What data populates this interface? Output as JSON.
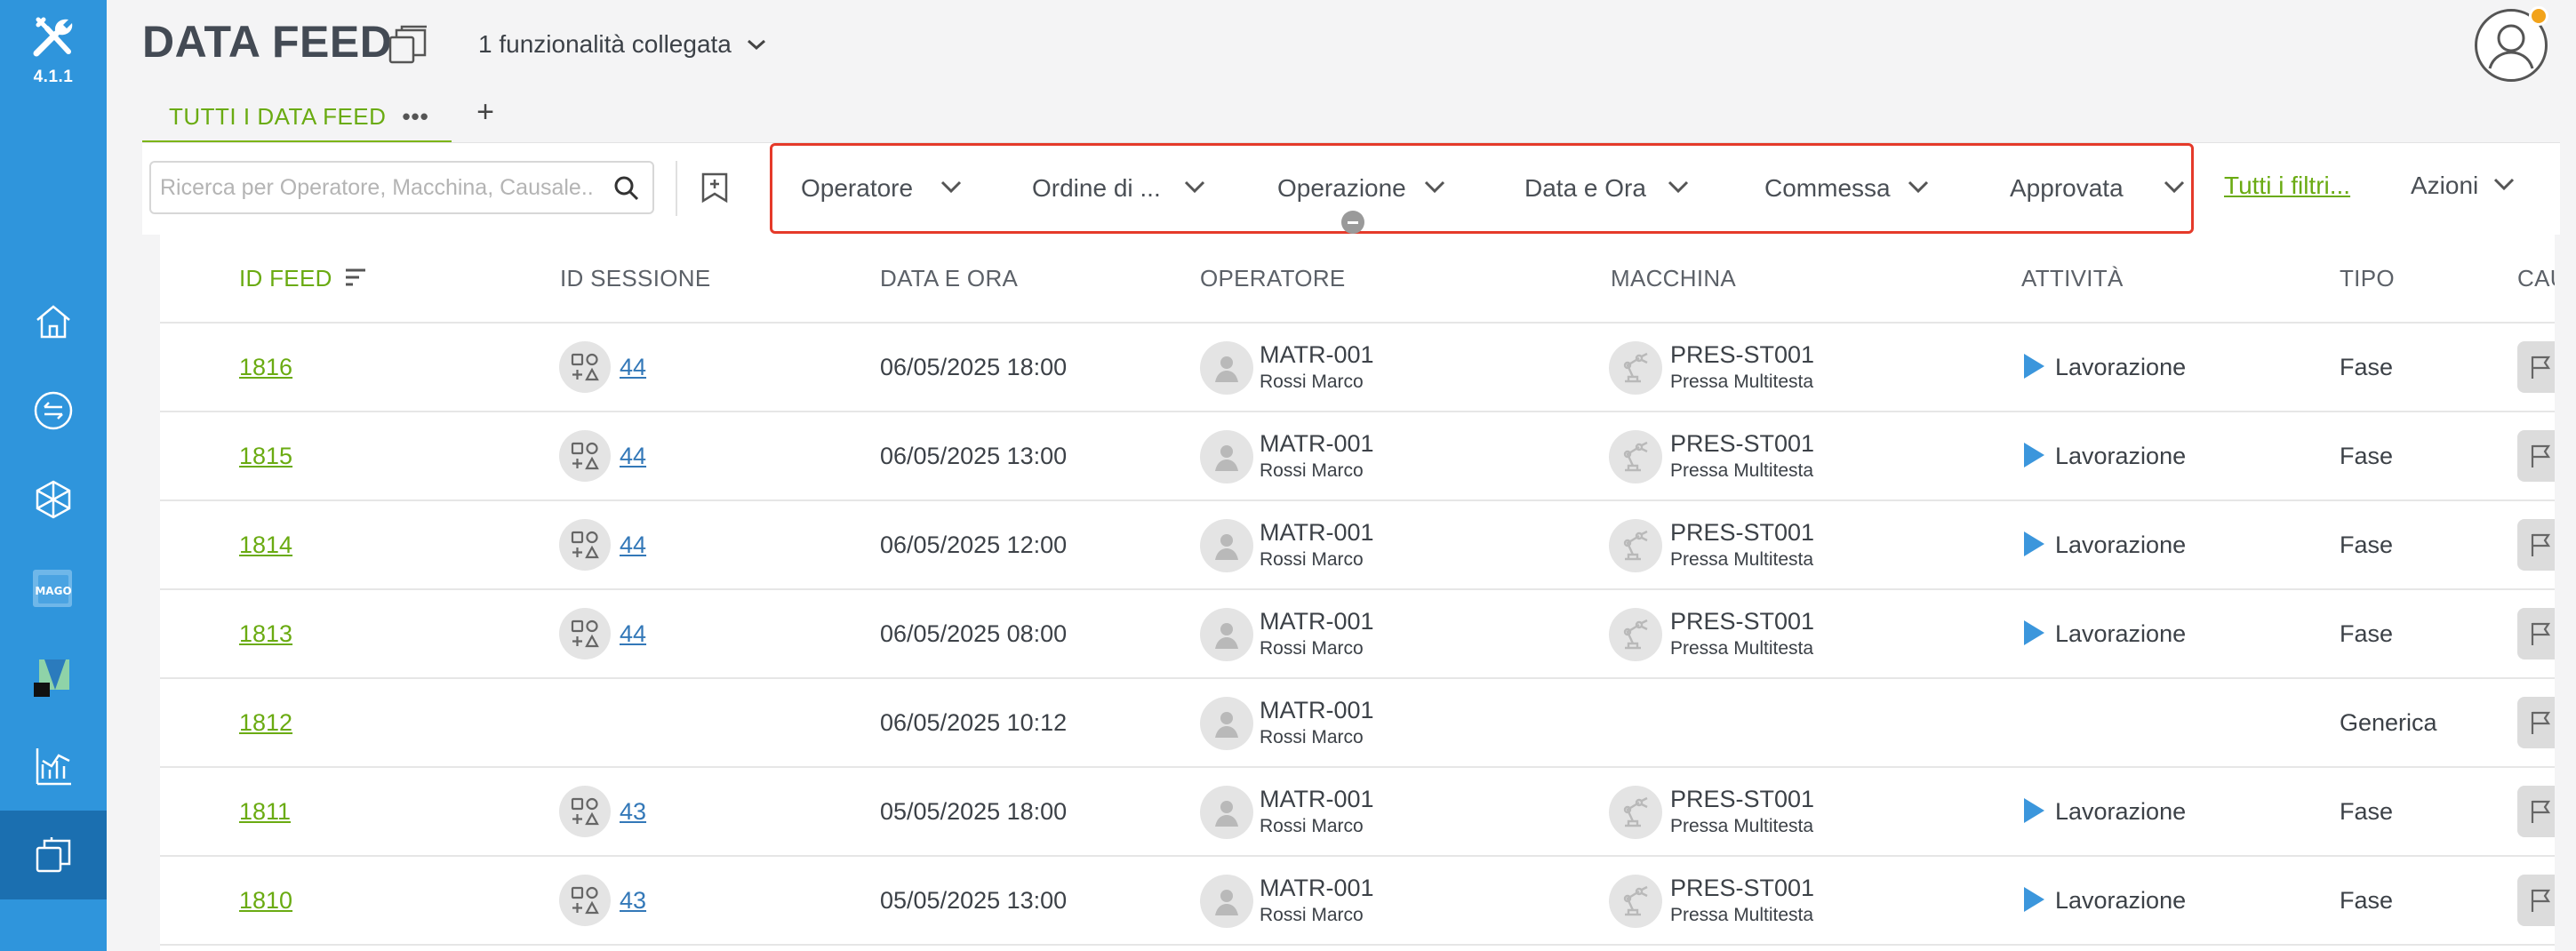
{
  "app": {
    "version": "4.1.1"
  },
  "header": {
    "title": "DATA FEED",
    "linked_features": "1 funzionalità collegata"
  },
  "tabs": [
    {
      "label": "TUTTI I DATA FEED",
      "more": "•••"
    }
  ],
  "tab_add_label": "+",
  "toolbar": {
    "search_placeholder": "Ricerca per Operatore, Macchina, Causale...",
    "filters": [
      "Operatore",
      "Ordine di ...",
      "Operazione",
      "Data e Ora",
      "Commessa",
      "Approvata"
    ],
    "all_filters": "Tutti i filtri...",
    "actions": "Azioni"
  },
  "table": {
    "columns": [
      "ID FEED",
      "ID SESSIONE",
      "DATA E ORA",
      "OPERATORE",
      "MACCHINA",
      "ATTIVITÀ",
      "TIPO",
      "CAU"
    ],
    "rows": [
      {
        "id": "1816",
        "session": "44",
        "datetime": "06/05/2025 18:00",
        "op_code": "MATR-001",
        "op_name": "Rossi Marco",
        "machine_code": "PRES-ST001",
        "machine_name": "Pressa Multitesta",
        "activity": "Lavorazione",
        "type": "Fase"
      },
      {
        "id": "1815",
        "session": "44",
        "datetime": "06/05/2025 13:00",
        "op_code": "MATR-001",
        "op_name": "Rossi Marco",
        "machine_code": "PRES-ST001",
        "machine_name": "Pressa Multitesta",
        "activity": "Lavorazione",
        "type": "Fase"
      },
      {
        "id": "1814",
        "session": "44",
        "datetime": "06/05/2025 12:00",
        "op_code": "MATR-001",
        "op_name": "Rossi Marco",
        "machine_code": "PRES-ST001",
        "machine_name": "Pressa Multitesta",
        "activity": "Lavorazione",
        "type": "Fase"
      },
      {
        "id": "1813",
        "session": "44",
        "datetime": "06/05/2025 08:00",
        "op_code": "MATR-001",
        "op_name": "Rossi Marco",
        "machine_code": "PRES-ST001",
        "machine_name": "Pressa Multitesta",
        "activity": "Lavorazione",
        "type": "Fase"
      },
      {
        "id": "1812",
        "session": "",
        "datetime": "06/05/2025 10:12",
        "op_code": "MATR-001",
        "op_name": "Rossi Marco",
        "machine_code": "",
        "machine_name": "",
        "activity": "",
        "type": "Generica"
      },
      {
        "id": "1811",
        "session": "43",
        "datetime": "05/05/2025 18:00",
        "op_code": "MATR-001",
        "op_name": "Rossi Marco",
        "machine_code": "PRES-ST001",
        "machine_name": "Pressa Multitesta",
        "activity": "Lavorazione",
        "type": "Fase"
      },
      {
        "id": "1810",
        "session": "43",
        "datetime": "05/05/2025 13:00",
        "op_code": "MATR-001",
        "op_name": "Rossi Marco",
        "machine_code": "PRES-ST001",
        "machine_name": "Pressa Multitesta",
        "activity": "Lavorazione",
        "type": "Fase"
      }
    ]
  },
  "colors": {
    "rail": "#2f95dc",
    "rail_active": "#1b6fb0",
    "accent_green": "#6aab12",
    "link_blue": "#3378b8",
    "highlight_red": "#e53a2a"
  },
  "icons": {
    "nav": [
      "home-icon",
      "exchange-icon",
      "cube-network-icon",
      "mago-app-icon",
      "app-icon",
      "chart-icon",
      "windows-icon"
    ]
  }
}
